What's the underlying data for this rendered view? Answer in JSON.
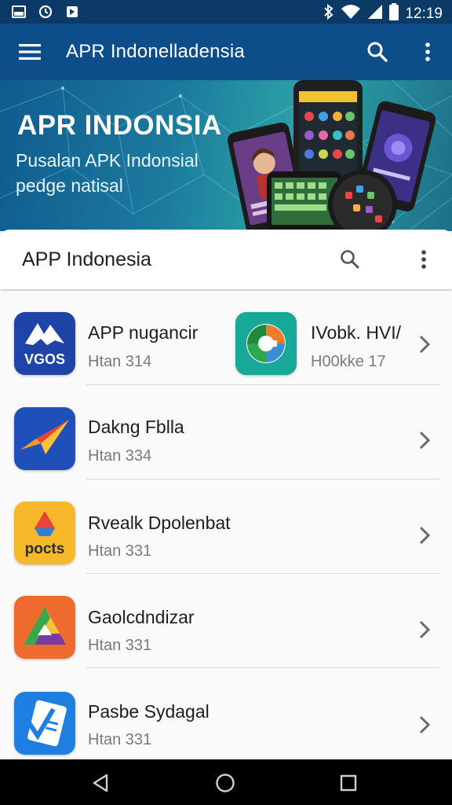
{
  "status_bar": {
    "time": "12:19",
    "left_icons": [
      "gallery-icon",
      "sync-icon",
      "app-icon"
    ],
    "right_icons": [
      "bluetooth-icon",
      "wifi-icon",
      "signal-icon",
      "battery-icon"
    ]
  },
  "app_bar": {
    "title": "APR Indonelladensia",
    "icons": [
      "menu-icon",
      "search-icon",
      "more-vert-icon"
    ]
  },
  "banner": {
    "title": "APR INDONSIA",
    "subtitle": "Pusalan APK Indonsial pedge natisal"
  },
  "search_card": {
    "title": "APP Indonesia",
    "icons": [
      "search-icon",
      "more-vert-icon"
    ]
  },
  "apps": [
    {
      "name": "APP nugancir",
      "meta": "Htan 314",
      "icon": "vgos-logo-icon",
      "icon_label": "VGOS"
    },
    {
      "name": "IVobk. HVI/",
      "meta": "H00kke 17",
      "icon": "g-circle-logo-icon"
    },
    {
      "name": "Dakng Fblla",
      "meta": "Htan 334",
      "icon": "paper-plane-logo-icon"
    },
    {
      "name": "Rvealk Dpolenbat",
      "meta": "Htan 331",
      "icon": "pocts-logo-icon",
      "icon_label": "pocts"
    },
    {
      "name": "Gaolcdndizar",
      "meta": "Htan 331",
      "icon": "triangle-logo-icon"
    },
    {
      "name": "Pasbe Sydagal",
      "meta": "Htan 331",
      "icon": "document-logo-icon"
    }
  ],
  "colors": {
    "status_bar": "#0b3a66",
    "app_bar": "#0d4d8a",
    "banner_start": "#0f5b8e",
    "banner_end": "#2ba3a6",
    "nav_bar": "#000000"
  },
  "nav_bar": {
    "icons": [
      "back-icon",
      "home-icon",
      "recents-icon"
    ]
  }
}
